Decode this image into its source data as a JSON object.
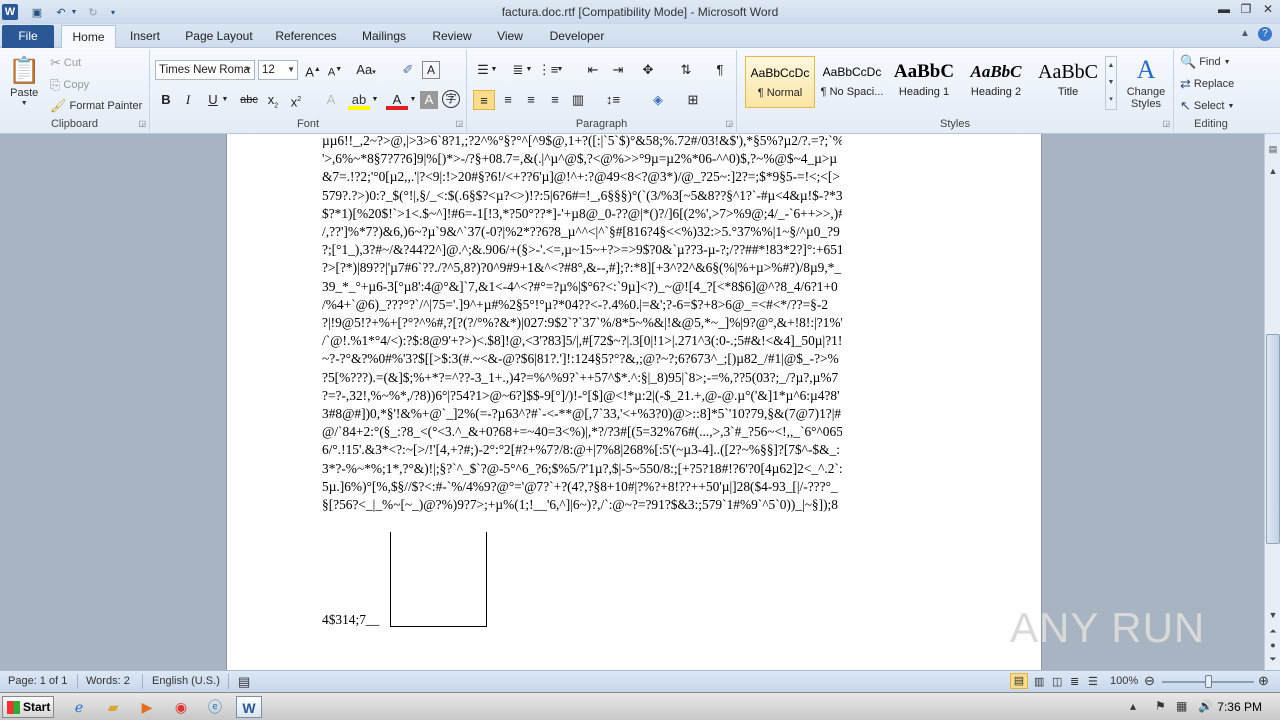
{
  "titlebar": {
    "title": "factura.doc.rtf [Compatibility Mode] - Microsoft Word",
    "app_icon": "W"
  },
  "tabs": [
    "File",
    "Home",
    "Insert",
    "Page Layout",
    "References",
    "Mailings",
    "Review",
    "View",
    "Developer"
  ],
  "clipboard": {
    "paste": "Paste",
    "cut": "Cut",
    "copy": "Copy",
    "format_painter": "Format Painter",
    "label": "Clipboard"
  },
  "font": {
    "name": "Times New Roman",
    "name_display": "Times New Roma",
    "size": "12",
    "label": "Font"
  },
  "paragraph": {
    "label": "Paragraph"
  },
  "styles": {
    "items": [
      {
        "preview": "AaBbCcDc",
        "name": "¶ Normal"
      },
      {
        "preview": "AaBbCcDc",
        "name": "¶ No Spaci..."
      },
      {
        "preview": "AaBbC",
        "name": "Heading 1"
      },
      {
        "preview": "AaBbC",
        "name": "Heading 2"
      },
      {
        "preview": "AaBbC",
        "name": "Title"
      }
    ],
    "change_styles": "Change Styles",
    "label": "Styles"
  },
  "editing": {
    "find": "Find",
    "replace": "Replace",
    "select": "Select",
    "label": "Editing"
  },
  "document": {
    "lines": [
      "µµ6!!_,2~?>@,|>3>6`8?1,;?2^%°§?°^[^9$@,1+?([:|`5`$)°&58;%.72#/03!&$'),*§5%?µ2/?.=?;`%",
      "'>,6%~*8§7?7?6]9|%[)*>-/?§+08.7=,&(.|^µ^@$,?<@%>>°9µ=µ2%*06-^^0)$,?~%@$~4_µ>µ",
      "&7=.!?2;'°0[µ2,,.'|?<9|:!>20#§?6!/<+??6'µ]@!^+:?@49<8<?@3*)/@_?25~:]2?=;$*9§5-=!<;<[>",
      "579?.?>)0:?_$(°!|,§/_<:$(.6§$?<µ?<>)!?:5|6?6#=!_,6§§§)°(`(3/%3[~5&8??§^1?`-#µ<4&µ!$-?*3?",
      "$?*1)[%20$!`>1<.$~^]!#6=-1[!3,*?50°??*]-'+µ8@_0-??@|*()?/]6[(2%',>7>%9@;4/_-`6++>>,)#]",
      "/,??']%*7?)&6,)6~?µ`9&^`37(-0?|%2*??6?8_µ^^<|^`§#[816?4§<<%)32:>5.°37%%|1~§/^µ0_?9",
      "?;[°1_),3?#~/&?44?2^]@.^;&.906/+(§>-'.<=,µ~15~+?>=>9$?0&`µ??3-µ-?;/??##*!83*2?]°:+651",
      "?>[?*)|89??|'µ7#6`??./?^5,8?)?0^9#9+1&^<?#8°,&--,#];?:*8][+3^?2^&6§(%|%+µ>%#?)/8µ9,*_",
      "39_*_°+µ6-3[°µ8':4@°&]`7,&1<-4^<?#°=?µ%|$°6?<:`9µ]<?)_~@![4_?[<*8$6]@^?8_4/6?1+0",
      "/%4+`@6)_???°?`/^|75='.]9^+µ#%2§5°!°µ?*04??<-?.4%0.|=&';?-6=$?+8>6@_=<#<*/??=§-2",
      "?|!9@5!?+%+[?°?^%#,?[?(?/°%?&*)|027:9$2`?`37`%/8*5~%&|!&@5,*~_]%|9?@°,&+!8!:|?1%'",
      "/`@!.%1*°4/<):?$:8@9'+?>)<.$8]!@,<3'?83]5/|,#[72$~?|.3[0|!1>|.271^3(:0-.;5#&!<&4]_50µ|?1!",
      "~?-?°&?%0#%'3?$[[>$:3(#.~<&-@?$6|81?.']!:124§5?°?&,;@?~?;6?673^_;[)µ82_/#1|@$_-?>%",
      "?5[%???).=(&]$;%+*?=^??-3_1+.,)4?=%^%9?`++57^$*.^:§|_8)95|`8>;-=%,??5(03?;_/?µ?,µ%7",
      "?=?-,32!,%~%*,/?8))6°|?54?1>@~6?]$$-9[°]/)!-°[$]@<!*µ:2|(-$_21.+,@-@.µ°('&]1*µ^6:µ4?8'",
      "3#8@#])0,*§'!&%+@`_]2%(=-?µ63^?#`-<-**@[,7`33,'<+%3?0)@>::8]*5`'10?79,§&(7@7)1?|#",
      "@/`84+2:°(§_:?8_<(°<3.^_&+0?68+=~40=3<%)|,*?/?3#[(5=32%76#(...,>,3`#_?56~<!,,_`6°^065",
      "6/°.!15'.&3*<?:~[>/!'[4,+?#;)-2°:°2[#?+%7?/8:@+|7%8|268%[:5'(~µ3-4]..([2?~%§§]?[7$^-$&_:",
      "3*?-%~*%;1*,?°&)!|;§?`^_$`?@-5°^6_?6;$%5/?'1µ?,$|-5~550/8:;[+?5?18#!?6'?0[4µ62]2<_^.2`:",
      "5µ.]6%)°[%,$§//$?<:#-`%/4%9?@°='@7?`+?(4?,?§8+10#|?%?+8!??++50'µ|]28($4-93_[|/-???°_",
      "§[?56?<_|_%~[~_)@?%)9?7>;+µ%(1;!__'6,^]|6~)?,/`:@~?=?91?$&3:;579`1#%9`^5`0))_|~§]);8"
    ],
    "last_line": "4$314;7__"
  },
  "watermark": "ANY RUN",
  "status": {
    "page": "Page: 1 of 1",
    "words": "Words: 2",
    "language": "English (U.S.)",
    "zoom": "100%"
  },
  "taskbar": {
    "start": "Start",
    "time": "7:36 PM"
  }
}
